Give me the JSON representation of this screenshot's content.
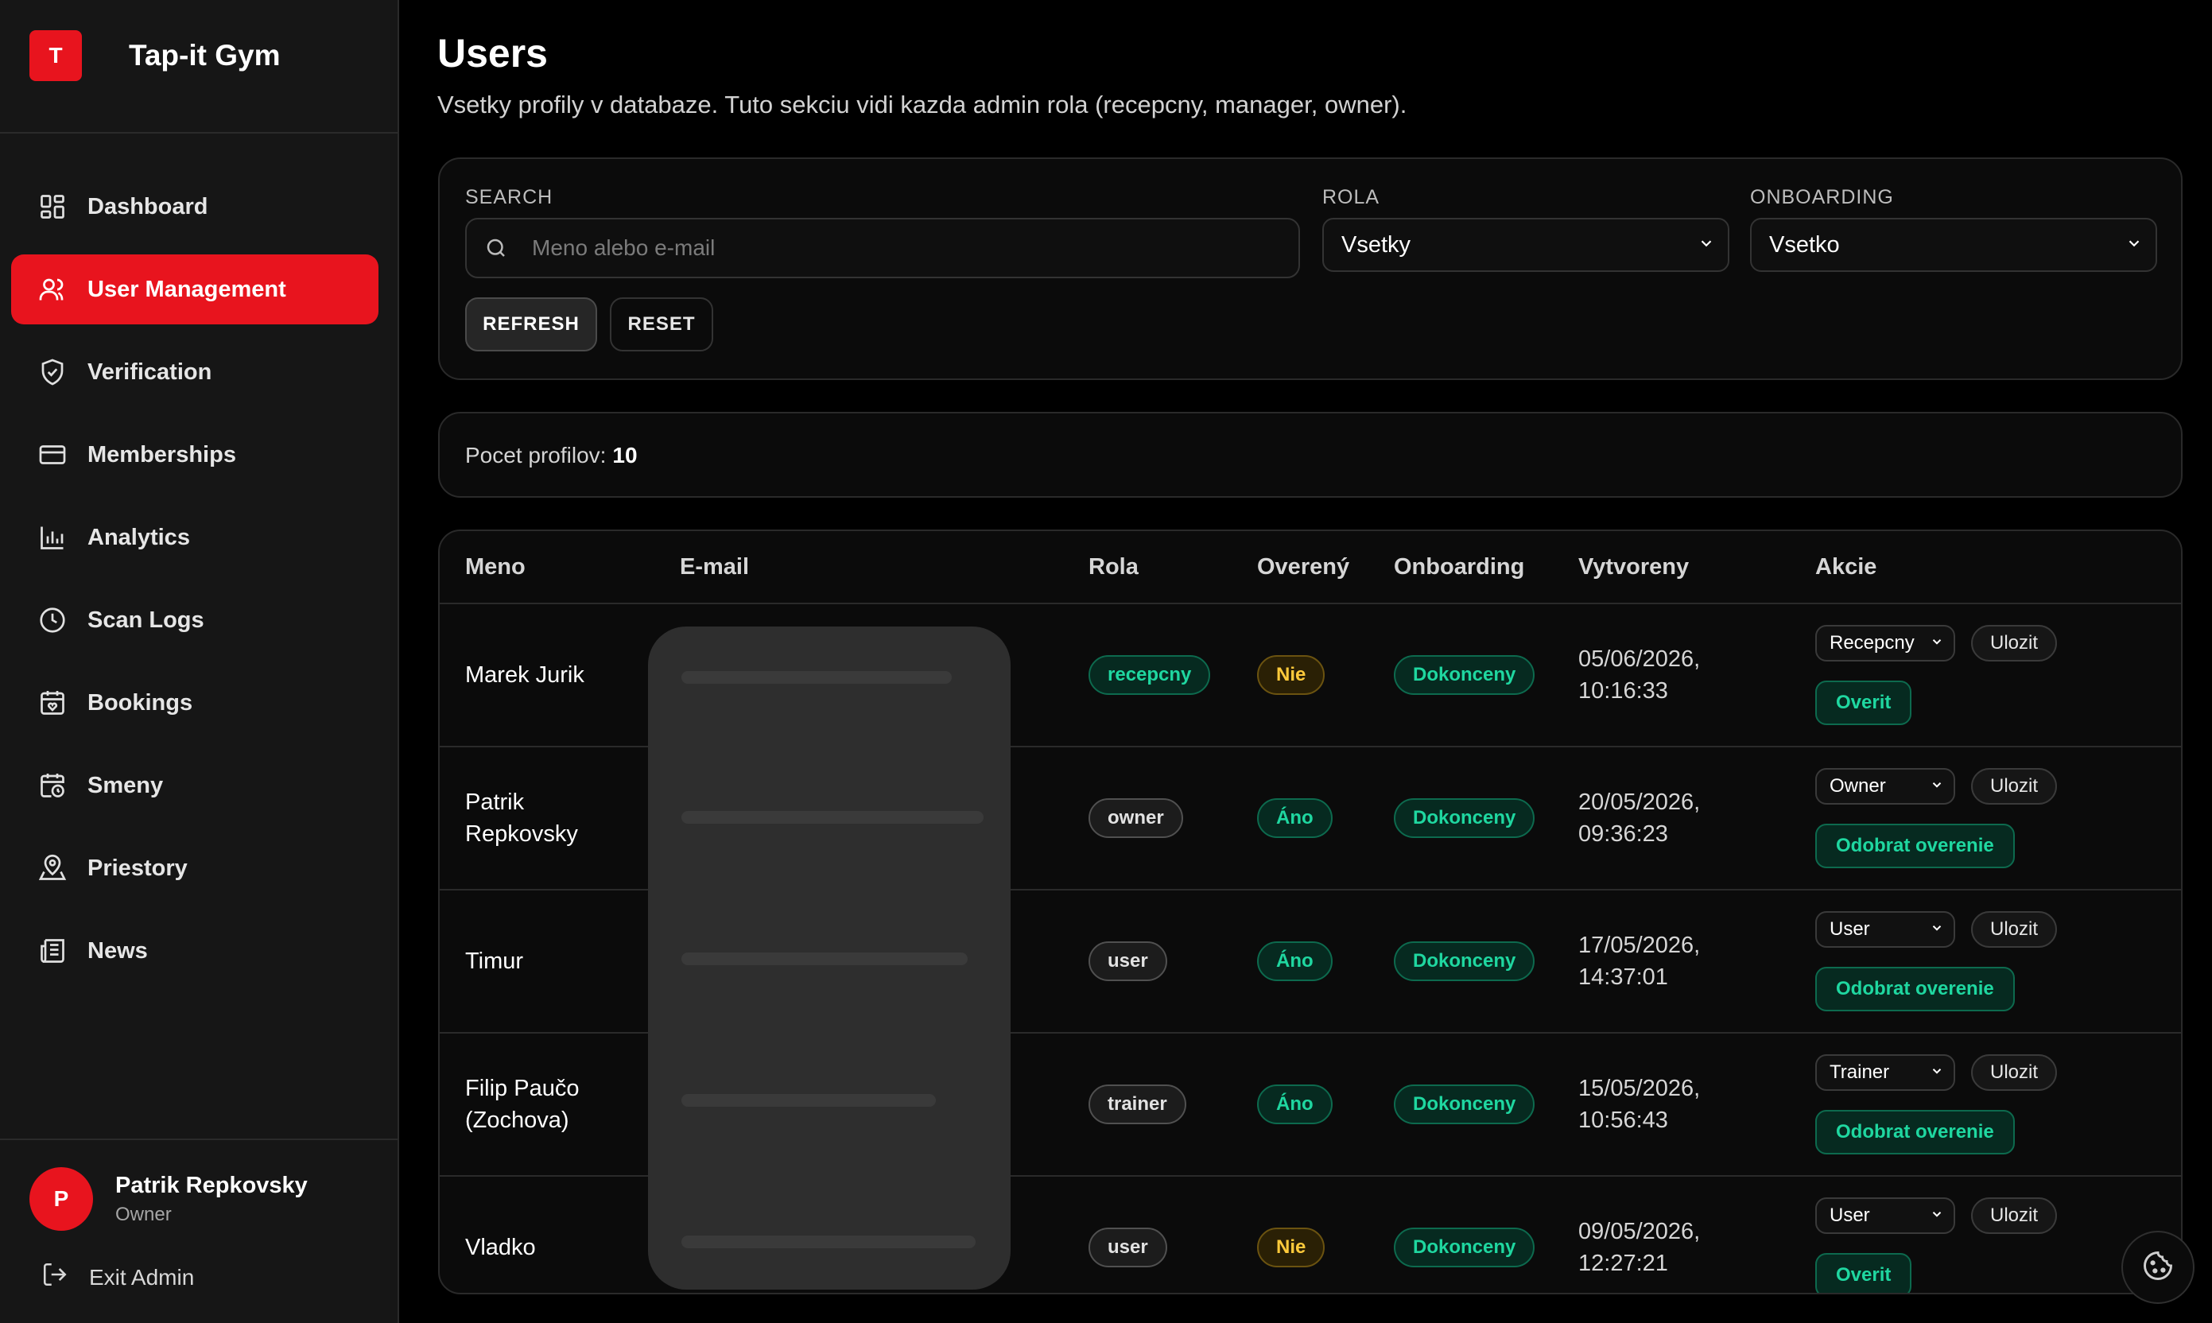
{
  "app": {
    "logo_letter": "T",
    "name": "Tap-it Gym"
  },
  "sidebar": {
    "items": [
      {
        "label": "Dashboard",
        "icon": "dashboard-icon"
      },
      {
        "label": "User Management",
        "icon": "users-icon",
        "active": true
      },
      {
        "label": "Verification",
        "icon": "shield-check-icon"
      },
      {
        "label": "Memberships",
        "icon": "card-icon"
      },
      {
        "label": "Analytics",
        "icon": "bar-chart-icon"
      },
      {
        "label": "Scan Logs",
        "icon": "clock-icon"
      },
      {
        "label": "Bookings",
        "icon": "calendar-heart-icon"
      },
      {
        "label": "Smeny",
        "icon": "calendar-clock-icon"
      },
      {
        "label": "Priestory",
        "icon": "map-pin-icon"
      },
      {
        "label": "News",
        "icon": "newspaper-icon"
      }
    ],
    "user": {
      "initial": "P",
      "name": "Patrik Repkovsky",
      "role": "Owner"
    },
    "exit_label": "Exit Admin"
  },
  "page": {
    "title": "Users",
    "subtitle": "Vsetky profily v databaze. Tuto sekciu vidi kazda admin rola (recepcny, manager, owner)."
  },
  "filters": {
    "search_label": "SEARCH",
    "search_placeholder": "Meno alebo e-mail",
    "search_value": "",
    "role_label": "ROLA",
    "role_value": "Vsetky",
    "onboarding_label": "ONBOARDING",
    "onboarding_value": "Vsetko",
    "refresh_label": "REFRESH",
    "reset_label": "RESET"
  },
  "summary": {
    "label": "Pocet profilov:",
    "count": "10"
  },
  "table": {
    "headers": {
      "name": "Meno",
      "email": "E-mail",
      "role": "Rola",
      "verified": "Overený",
      "onboarding": "Onboarding",
      "created": "Vytvoreny",
      "actions": "Akcie"
    },
    "save_label": "Ulozit",
    "rows": [
      {
        "name_l1": "Marek Jurik",
        "name_l2": "",
        "role": "recepcny",
        "role_style": "green",
        "verified": "Nie",
        "verified_style": "amber",
        "onboarding": "Dokonceny",
        "date": "05/06/2026,",
        "time": "10:16:33",
        "role_select": "Recepcny",
        "verify_action": "Overit"
      },
      {
        "name_l1": "Patrik",
        "name_l2": "Repkovsky",
        "role": "owner",
        "role_style": "neutral",
        "verified": "Áno",
        "verified_style": "green",
        "onboarding": "Dokonceny",
        "date": "20/05/2026,",
        "time": "09:36:23",
        "role_select": "Owner",
        "verify_action": "Odobrat overenie"
      },
      {
        "name_l1": "Timur",
        "name_l2": "",
        "role": "user",
        "role_style": "neutral",
        "verified": "Áno",
        "verified_style": "green",
        "onboarding": "Dokonceny",
        "date": "17/05/2026,",
        "time": "14:37:01",
        "role_select": "User",
        "verify_action": "Odobrat overenie"
      },
      {
        "name_l1": "Filip Paučo",
        "name_l2": "(Zochova)",
        "role": "trainer",
        "role_style": "neutral",
        "verified": "Áno",
        "verified_style": "green",
        "onboarding": "Dokonceny",
        "date": "15/05/2026,",
        "time": "10:56:43",
        "role_select": "Trainer",
        "verify_action": "Odobrat overenie"
      },
      {
        "name_l1": "Vladko",
        "name_l2": "",
        "role": "user",
        "role_style": "neutral",
        "verified": "Nie",
        "verified_style": "amber",
        "onboarding": "Dokonceny",
        "date": "09/05/2026,",
        "time": "12:27:21",
        "role_select": "User",
        "verify_action": "Overit"
      }
    ]
  },
  "colors": {
    "accent": "#e8141e",
    "success": "#1fd7a0",
    "warning": "#ffca3b",
    "background": "#000000",
    "sidebar": "#161616"
  }
}
